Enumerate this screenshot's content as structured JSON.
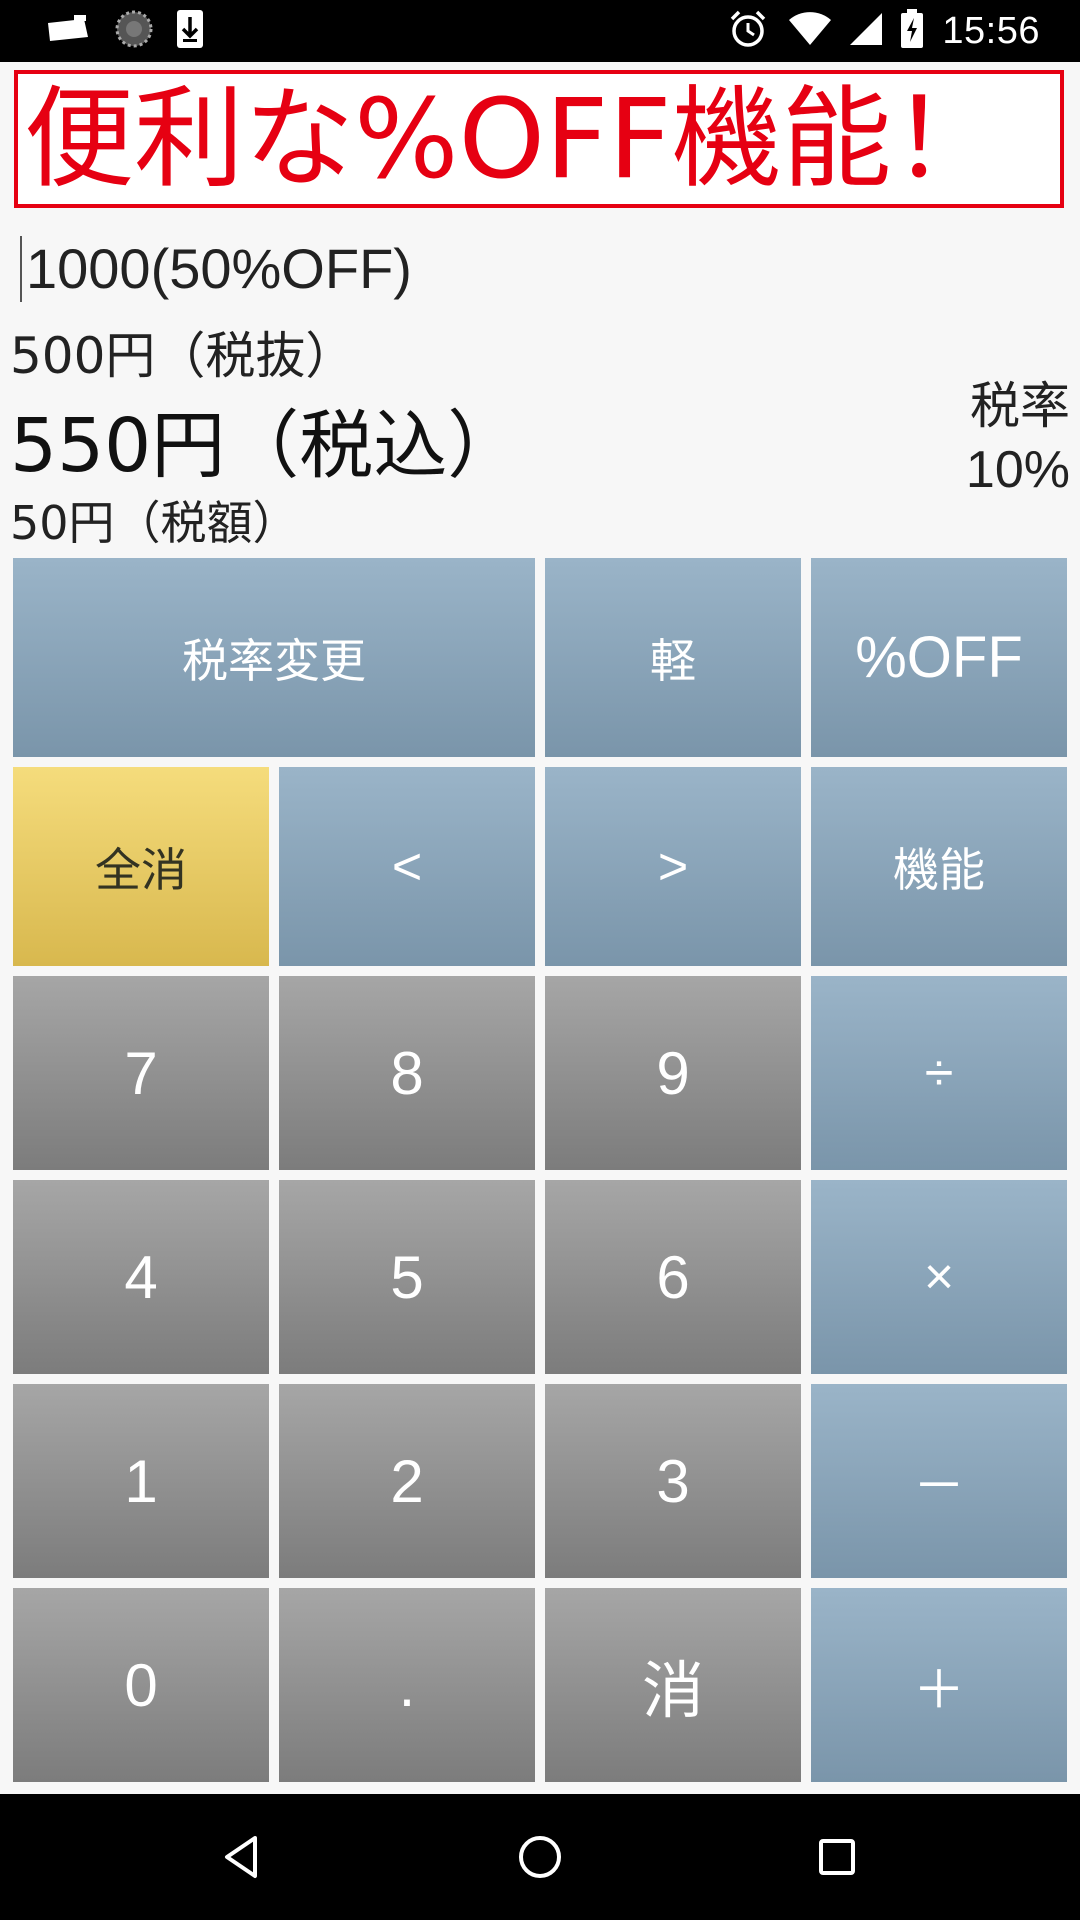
{
  "status_bar": {
    "time": "15:56",
    "left_icons": [
      "notification-card-icon",
      "loading-spinner-icon",
      "download-icon"
    ],
    "right_icons": [
      "alarm-icon",
      "wifi-icon",
      "signal-icon",
      "battery-charging-icon"
    ]
  },
  "banner": {
    "text": "便利な%OFF機能！",
    "color": "#e60012"
  },
  "display": {
    "expression": "1000(50%OFF)",
    "price_excl": "500円（税抜）",
    "price_incl": "550円（税込）",
    "tax_amount": "50円（税額）",
    "tax_rate_label": "税率",
    "tax_rate_value": "10%"
  },
  "keys": {
    "tax_change": "税率変更",
    "reduced": "軽",
    "percent_off": "%OFF",
    "all_clear": "全消",
    "left": "<",
    "right": ">",
    "function": "機能",
    "seven": "7",
    "eight": "8",
    "nine": "9",
    "divide": "÷",
    "four": "4",
    "five": "5",
    "six": "6",
    "multiply": "×",
    "one": "1",
    "two": "2",
    "three": "3",
    "minus": "－",
    "zero": "0",
    "dot": ".",
    "clear": "消",
    "plus": "＋"
  },
  "colors": {
    "function_key": "#8aa5b9",
    "number_key": "#929292",
    "clear_all_key": "#e8ca64",
    "banner_red": "#e60012"
  },
  "nav_bar": {
    "icons": [
      "back-icon",
      "home-icon",
      "recents-icon"
    ]
  }
}
